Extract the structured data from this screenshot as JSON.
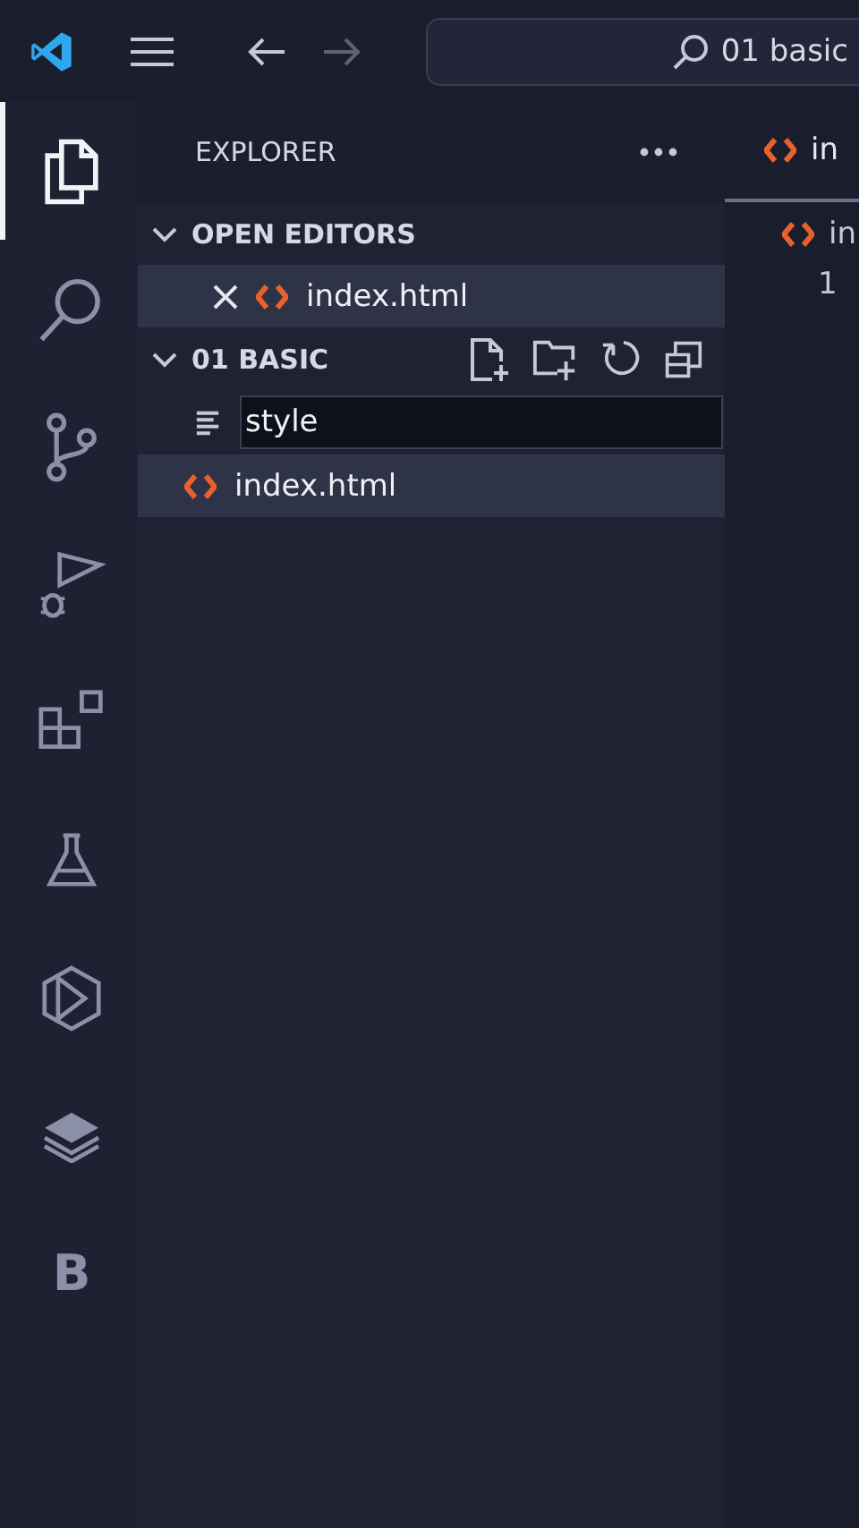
{
  "title_bar": {
    "search": "01 basic"
  },
  "activity_bar": {
    "items": [
      {
        "kind": "explorer",
        "selected": true
      },
      {
        "kind": "search",
        "selected": false
      },
      {
        "kind": "source-control",
        "selected": false
      },
      {
        "kind": "run-debug",
        "selected": false
      },
      {
        "kind": "extensions",
        "selected": false
      },
      {
        "kind": "testing",
        "selected": false
      },
      {
        "kind": "hexagon",
        "selected": false
      },
      {
        "kind": "layers",
        "selected": false
      },
      {
        "kind": "letter",
        "label": "B",
        "selected": false
      }
    ]
  },
  "sidebar": {
    "title": "EXPLORER",
    "sections": [
      {
        "title": "OPEN EDITORS",
        "expanded": true,
        "items": [
          {
            "name": "index.html",
            "kind": "html",
            "selected": true,
            "closable": true
          }
        ]
      },
      {
        "title": "01 BASIC",
        "expanded": true,
        "new_file": {
          "value": "style"
        },
        "items": [
          {
            "name": "index.html",
            "kind": "html",
            "selected": true,
            "closable": false
          }
        ]
      }
    ]
  },
  "editor": {
    "tabs": [
      {
        "label": "in",
        "selected": true
      }
    ],
    "breadcrumb": "in",
    "line_numbers": [
      "1"
    ]
  }
}
